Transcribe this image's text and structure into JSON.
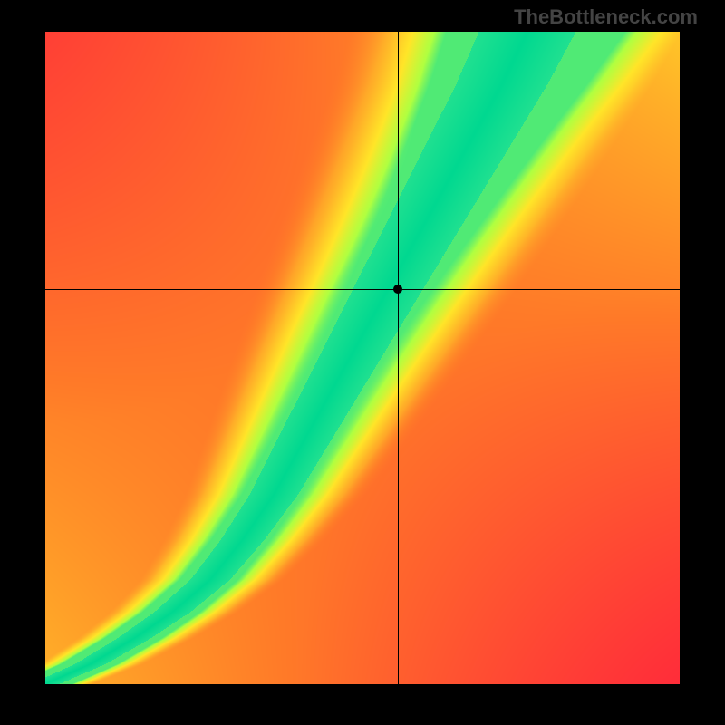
{
  "watermark": "TheBottleneck.com",
  "chart_data": {
    "type": "heatmap",
    "title": "",
    "xlabel": "",
    "ylabel": "",
    "x_range": [
      0,
      1
    ],
    "y_range": [
      0,
      1
    ],
    "crosshair": {
      "x": 0.555,
      "y": 0.605
    },
    "colorscale": [
      {
        "value": 0.0,
        "color": "#ff2a3a"
      },
      {
        "value": 0.35,
        "color": "#ff7a28"
      },
      {
        "value": 0.55,
        "color": "#ffb028"
      },
      {
        "value": 0.72,
        "color": "#ffe528"
      },
      {
        "value": 0.86,
        "color": "#b0ff40"
      },
      {
        "value": 0.95,
        "color": "#20e090"
      },
      {
        "value": 1.0,
        "color": "#00d890"
      }
    ],
    "ridge_points": [
      {
        "x": 0.0,
        "y": 0.0
      },
      {
        "x": 0.07,
        "y": 0.03
      },
      {
        "x": 0.14,
        "y": 0.07
      },
      {
        "x": 0.2,
        "y": 0.11
      },
      {
        "x": 0.26,
        "y": 0.16
      },
      {
        "x": 0.31,
        "y": 0.22
      },
      {
        "x": 0.36,
        "y": 0.29
      },
      {
        "x": 0.4,
        "y": 0.36
      },
      {
        "x": 0.44,
        "y": 0.43
      },
      {
        "x": 0.48,
        "y": 0.5
      },
      {
        "x": 0.52,
        "y": 0.57
      },
      {
        "x": 0.56,
        "y": 0.64
      },
      {
        "x": 0.6,
        "y": 0.71
      },
      {
        "x": 0.64,
        "y": 0.78
      },
      {
        "x": 0.68,
        "y": 0.85
      },
      {
        "x": 0.72,
        "y": 0.92
      },
      {
        "x": 0.76,
        "y": 1.0
      }
    ],
    "ridge_half_width": 0.045,
    "corner_values": {
      "top_left": 0.15,
      "top_right": 0.62,
      "bottom_left": 0.55,
      "bottom_right": 0.02
    }
  }
}
